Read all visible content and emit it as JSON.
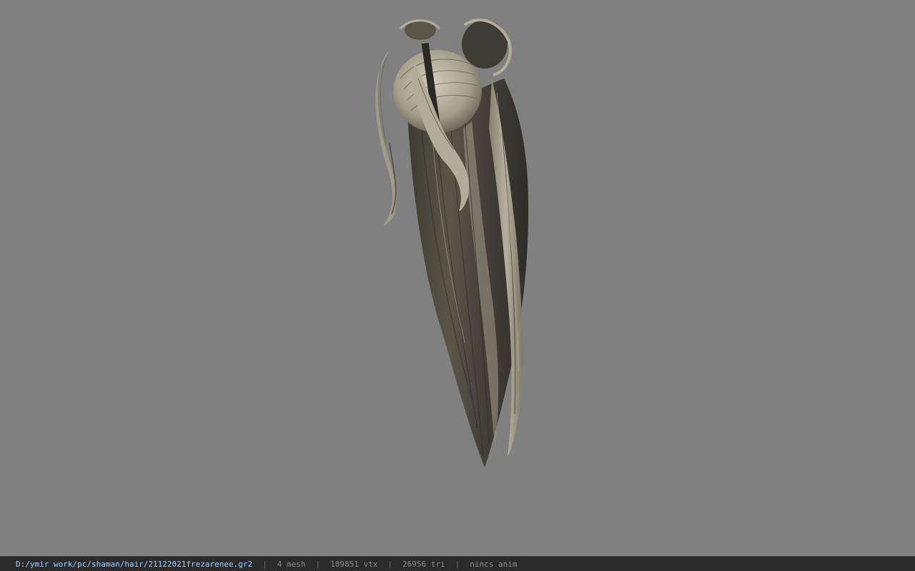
{
  "viewer": {
    "background_color": "#808080",
    "model": {
      "icon": "hair-model-icon",
      "base_color": "#4a473c",
      "highlight_color": "#b8b19f"
    }
  },
  "status_bar": {
    "file_path": "D:/ymir work/pc/shaman/hair/21122021frezarenee.gr2",
    "separator": "|",
    "mesh_count": "4 mesh",
    "vertex_count": "109851 vtx",
    "triangle_count": "26956 tri",
    "anim_status": "nincs anim",
    "path_color": "#9fd0ff"
  }
}
